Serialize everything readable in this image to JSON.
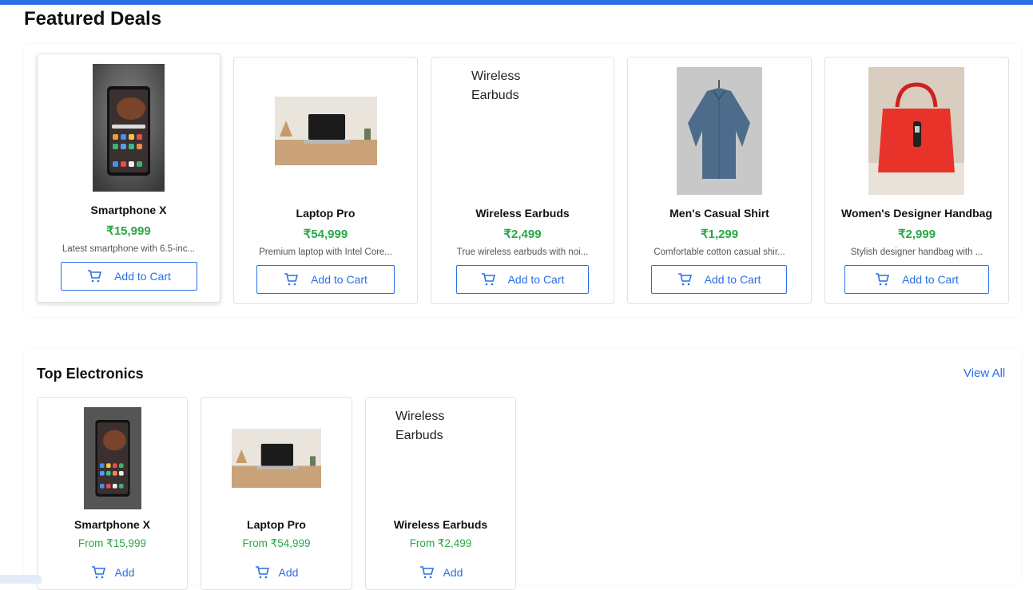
{
  "featured": {
    "title": "Featured Deals",
    "button_label": "Add to Cart",
    "products": [
      {
        "name": "Smartphone X",
        "price": "₹15,999",
        "desc": "Latest smartphone with 6.5-inc...",
        "image": "phone"
      },
      {
        "name": "Laptop Pro",
        "price": "₹54,999",
        "desc": "Premium laptop with Intel Core...",
        "image": "laptop"
      },
      {
        "name": "Wireless Earbuds",
        "price": "₹2,499",
        "desc": "True wireless earbuds with noi...",
        "image_alt": "Wireless Earbuds"
      },
      {
        "name": "Men's Casual Shirt",
        "price": "₹1,299",
        "desc": "Comfortable cotton casual shir...",
        "image": "shirt"
      },
      {
        "name": "Women's Designer Handbag",
        "price": "₹2,999",
        "desc": "Stylish designer handbag with ...",
        "image": "handbag"
      }
    ]
  },
  "electronics": {
    "title": "Top Electronics",
    "view_all": "View All",
    "button_label": "Add",
    "products": [
      {
        "name": "Smartphone X",
        "price": "From ₹15,999",
        "image": "phone"
      },
      {
        "name": "Laptop Pro",
        "price": "From ₹54,999",
        "image": "laptop"
      },
      {
        "name": "Wireless Earbuds",
        "price": "From ₹2,499",
        "image_alt": "Wireless Earbuds"
      }
    ]
  },
  "colors": {
    "accent": "#2a6fe8",
    "price": "#28a745"
  }
}
